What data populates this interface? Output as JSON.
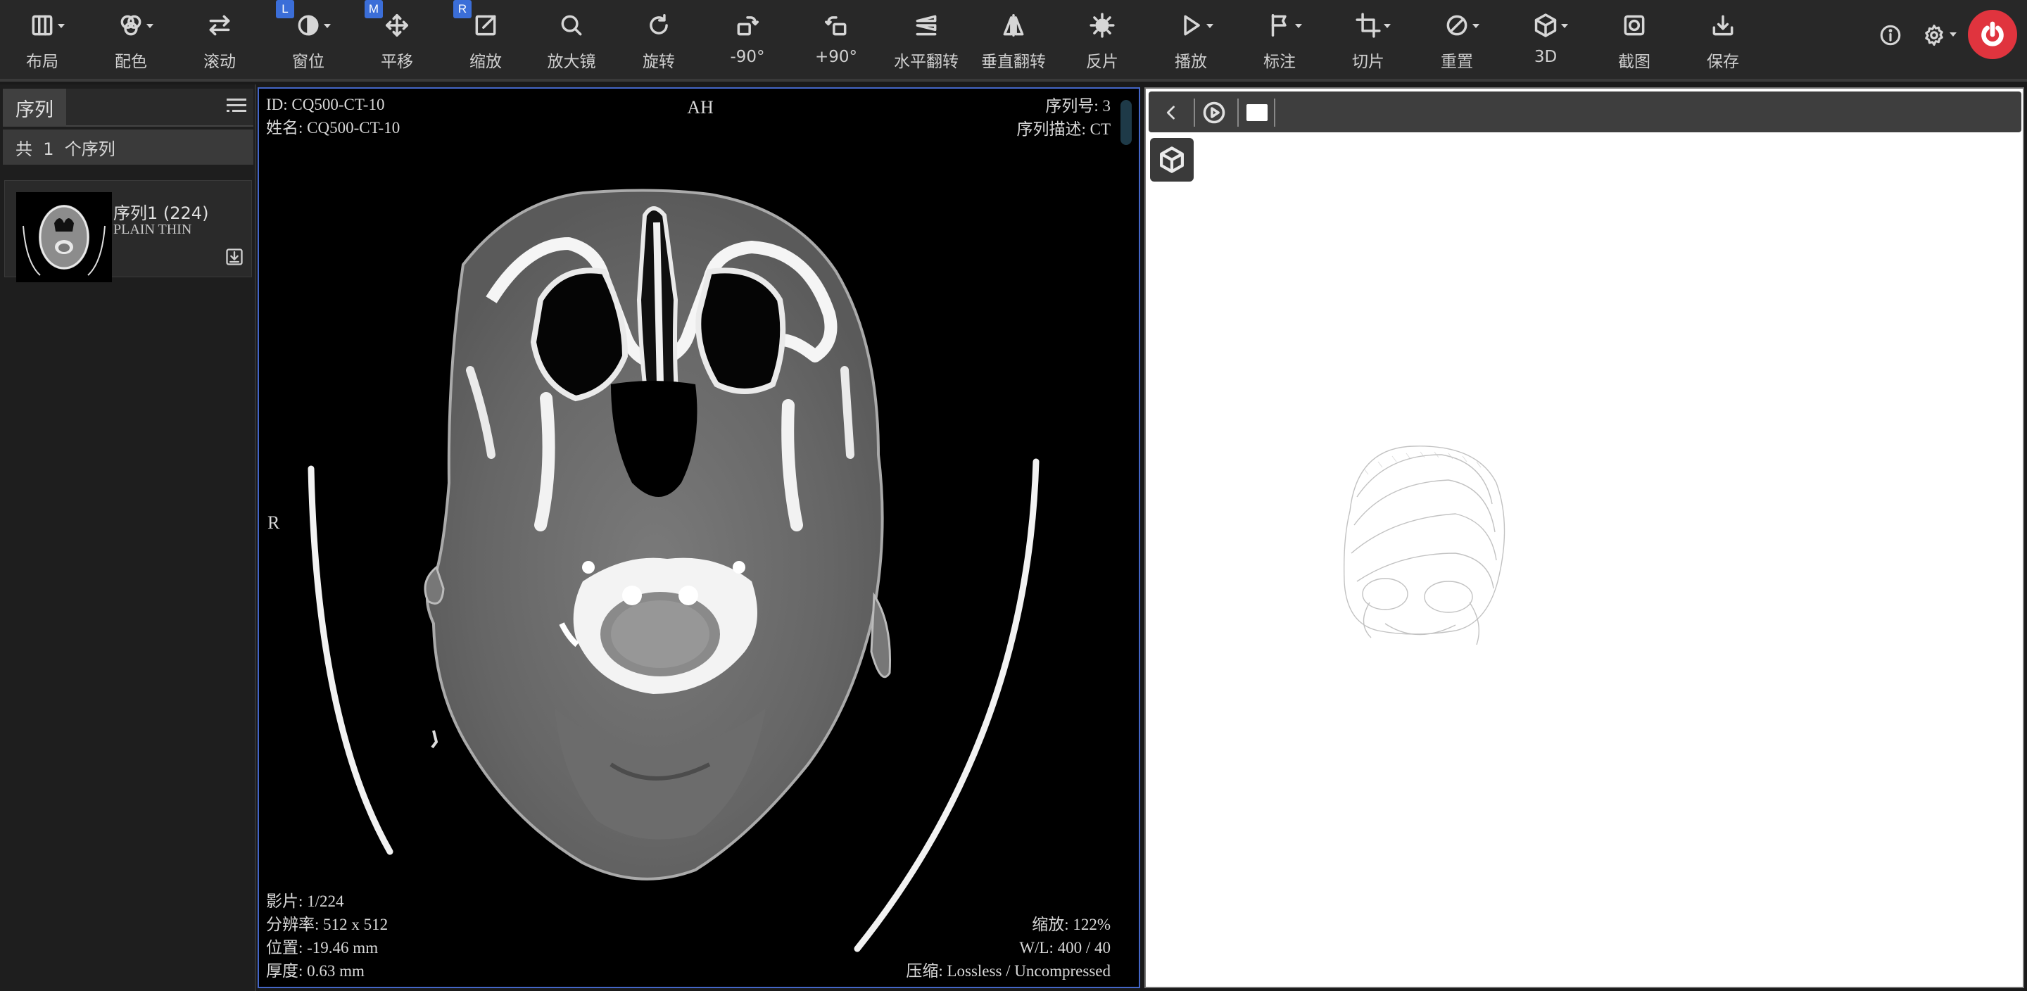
{
  "toolbar": {
    "tools": [
      {
        "id": "layout",
        "label": "布局",
        "icon": "layout-columns-icon",
        "dropdown": true
      },
      {
        "id": "colormap",
        "label": "配色",
        "icon": "color-palette-icon",
        "dropdown": true
      },
      {
        "id": "scroll",
        "label": "滚动",
        "icon": "scroll-arrows-icon",
        "dropdown": false
      },
      {
        "id": "window",
        "label": "窗位",
        "icon": "contrast-icon",
        "dropdown": true,
        "badge": "L"
      },
      {
        "id": "pan",
        "label": "平移",
        "icon": "move-icon",
        "dropdown": false,
        "badge": "M"
      },
      {
        "id": "zoom",
        "label": "缩放",
        "icon": "zoom-box-icon",
        "dropdown": false,
        "badge": "R"
      },
      {
        "id": "magnifier",
        "label": "放大镜",
        "icon": "magnifier-icon",
        "dropdown": false
      },
      {
        "id": "rotate",
        "label": "旋转",
        "icon": "rotate-icon",
        "dropdown": false
      },
      {
        "id": "rotate-ccw",
        "label": "-90°",
        "icon": "rotate-ccw-90-icon",
        "dropdown": false
      },
      {
        "id": "rotate-cw",
        "label": "+90°",
        "icon": "rotate-cw-90-icon",
        "dropdown": false
      },
      {
        "id": "flip-h",
        "label": "水平翻转",
        "icon": "flip-horizontal-icon",
        "dropdown": false
      },
      {
        "id": "flip-v",
        "label": "垂直翻转",
        "icon": "flip-vertical-icon",
        "dropdown": false
      },
      {
        "id": "invert",
        "label": "反片",
        "icon": "invert-sun-icon",
        "dropdown": false
      },
      {
        "id": "play",
        "label": "播放",
        "icon": "play-icon",
        "dropdown": true
      },
      {
        "id": "annotate",
        "label": "标注",
        "icon": "flag-icon",
        "dropdown": true
      },
      {
        "id": "slice",
        "label": "切片",
        "icon": "crop-icon",
        "dropdown": true
      },
      {
        "id": "reset",
        "label": "重置",
        "icon": "reset-slash-icon",
        "dropdown": true
      },
      {
        "id": "3d",
        "label": "3D",
        "icon": "cube-icon",
        "dropdown": true
      },
      {
        "id": "screenshot",
        "label": "截图",
        "icon": "screenshot-icon",
        "dropdown": false
      },
      {
        "id": "save",
        "label": "保存",
        "icon": "save-download-icon",
        "dropdown": false
      }
    ]
  },
  "left_panel": {
    "tab_label": "序列",
    "count_text": "共  1  个序列",
    "series": [
      {
        "name": "序列1 (224)",
        "description": "PLAIN THIN"
      }
    ]
  },
  "viewport": {
    "overlay": {
      "top_left": [
        "ID: CQ500-CT-10",
        "姓名: CQ500-CT-10"
      ],
      "top_center": "AH",
      "top_right": [
        "序列号: 3",
        "序列描述: CT"
      ],
      "left_middle": "R",
      "bottom_left": [
        "影片: 1/224",
        "分辨率: 512 x 512",
        "位置: -19.46 mm",
        "厚度: 0.63 mm"
      ],
      "bottom_right": [
        "缩放: 122%",
        "W/L: 400 / 40",
        "压缩: Lossless / Uncompressed"
      ]
    }
  },
  "colors": {
    "toolbar_bg": "#282828",
    "accent_blue": "#3b6ed8",
    "power_red": "#e0343e",
    "viewport_border": "#4466c8"
  }
}
